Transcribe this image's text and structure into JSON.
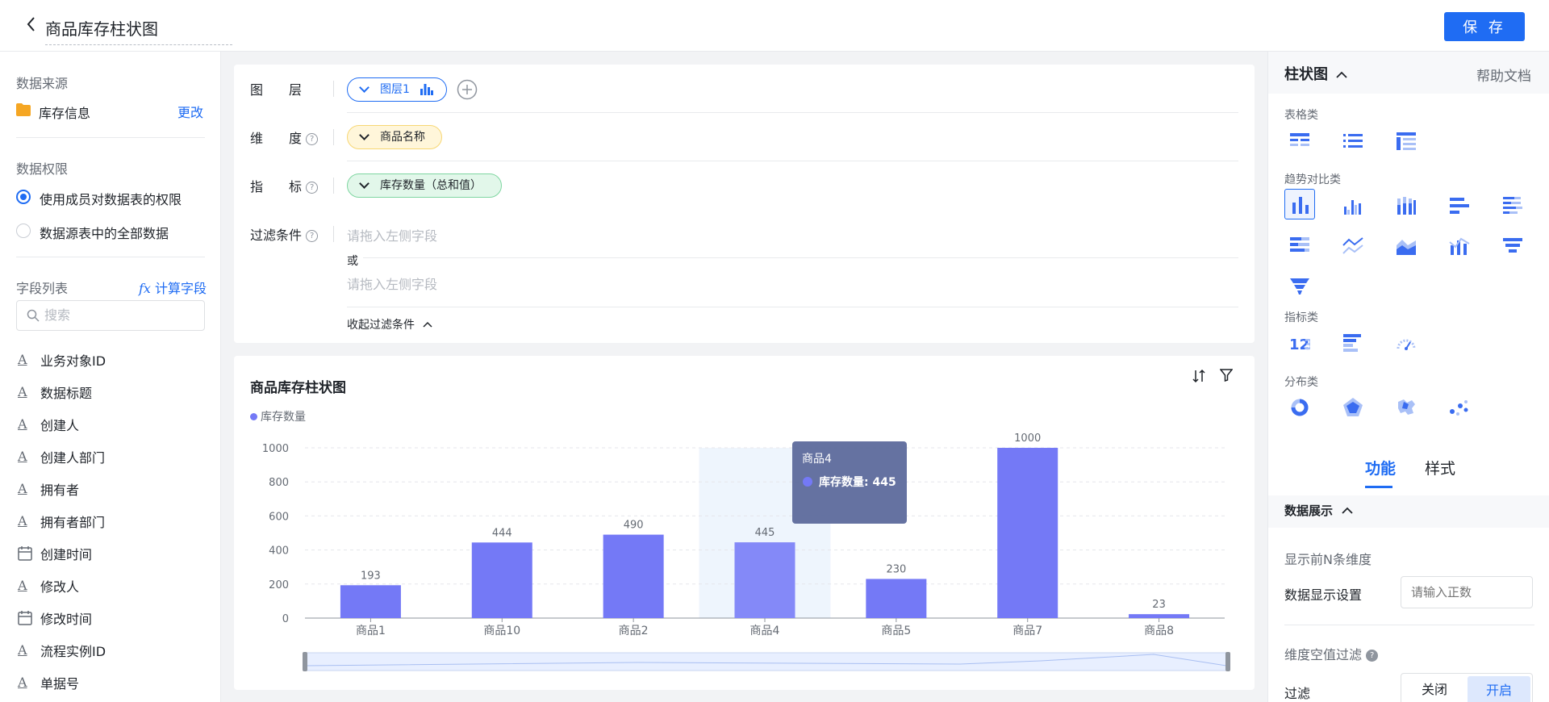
{
  "header": {
    "title": "商品库存柱状图",
    "save_label": "保 存"
  },
  "left": {
    "data_source_label": "数据来源",
    "data_source_name": "库存信息",
    "change_label": "更改",
    "permission_label": "数据权限",
    "permission_options": [
      "使用成员对数据表的权限",
      "数据源表中的全部数据"
    ],
    "field_list_label": "字段列表",
    "calc_field_label": "计算字段",
    "search_placeholder": "搜索",
    "fields": [
      {
        "name": "业务对象ID",
        "icon": "text-field-icon"
      },
      {
        "name": "数据标题",
        "icon": "text-field-icon"
      },
      {
        "name": "创建人",
        "icon": "text-field-icon"
      },
      {
        "name": "创建人部门",
        "icon": "text-field-icon"
      },
      {
        "name": "拥有者",
        "icon": "text-field-icon"
      },
      {
        "name": "拥有者部门",
        "icon": "text-field-icon"
      },
      {
        "name": "创建时间",
        "icon": "calendar-icon"
      },
      {
        "name": "修改人",
        "icon": "text-field-icon"
      },
      {
        "name": "修改时间",
        "icon": "calendar-icon"
      },
      {
        "name": "流程实例ID",
        "icon": "text-field-icon"
      },
      {
        "name": "单据号",
        "icon": "text-field-icon"
      }
    ]
  },
  "config": {
    "layer_label": "图　　层",
    "layer_pill": "图层1",
    "dimension_label": "维　　度",
    "dimension_pill": "商品名称",
    "metric_label": "指　　标",
    "metric_pill": "库存数量（总和值）",
    "filter_label": "过滤条件",
    "filter_placeholder": "请拖入左侧字段",
    "or_label": "或",
    "collapse_label": "收起过滤条件"
  },
  "chart_data": {
    "type": "bar",
    "title": "商品库存柱状图",
    "categories": [
      "商品1",
      "商品10",
      "商品2",
      "商品4",
      "商品5",
      "商品7",
      "商品8"
    ],
    "series": [
      {
        "name": "库存数量",
        "values": [
          193,
          444,
          490,
          445,
          230,
          1000,
          23
        ]
      }
    ],
    "ylim": [
      0,
      1000
    ],
    "yticks": [
      0,
      200,
      400,
      600,
      800,
      1000
    ],
    "legend": "top-left",
    "grid": true,
    "highlighted_index": 3,
    "tooltip": {
      "title": "商品4",
      "label": "库存数量: 445"
    },
    "bar_color": "#7479f6",
    "highlight_color": "#8489f8"
  },
  "right": {
    "title": "柱状图",
    "help_label": "帮助文档",
    "sections": [
      "表格类",
      "趋势对比类",
      "指标类",
      "分布类"
    ],
    "tabs": [
      "功能",
      "样式"
    ],
    "data_display_label": "数据展示",
    "topn_label": "显示前N条维度",
    "display_setting_label": "数据显示设置",
    "display_setting_placeholder": "请输入正数",
    "null_filter_label": "维度空值过滤",
    "filter_label": "过滤",
    "toggle": [
      "关闭",
      "开启"
    ]
  },
  "colors": {
    "accent": "#1f6cf3",
    "bar": "#7479f6"
  }
}
